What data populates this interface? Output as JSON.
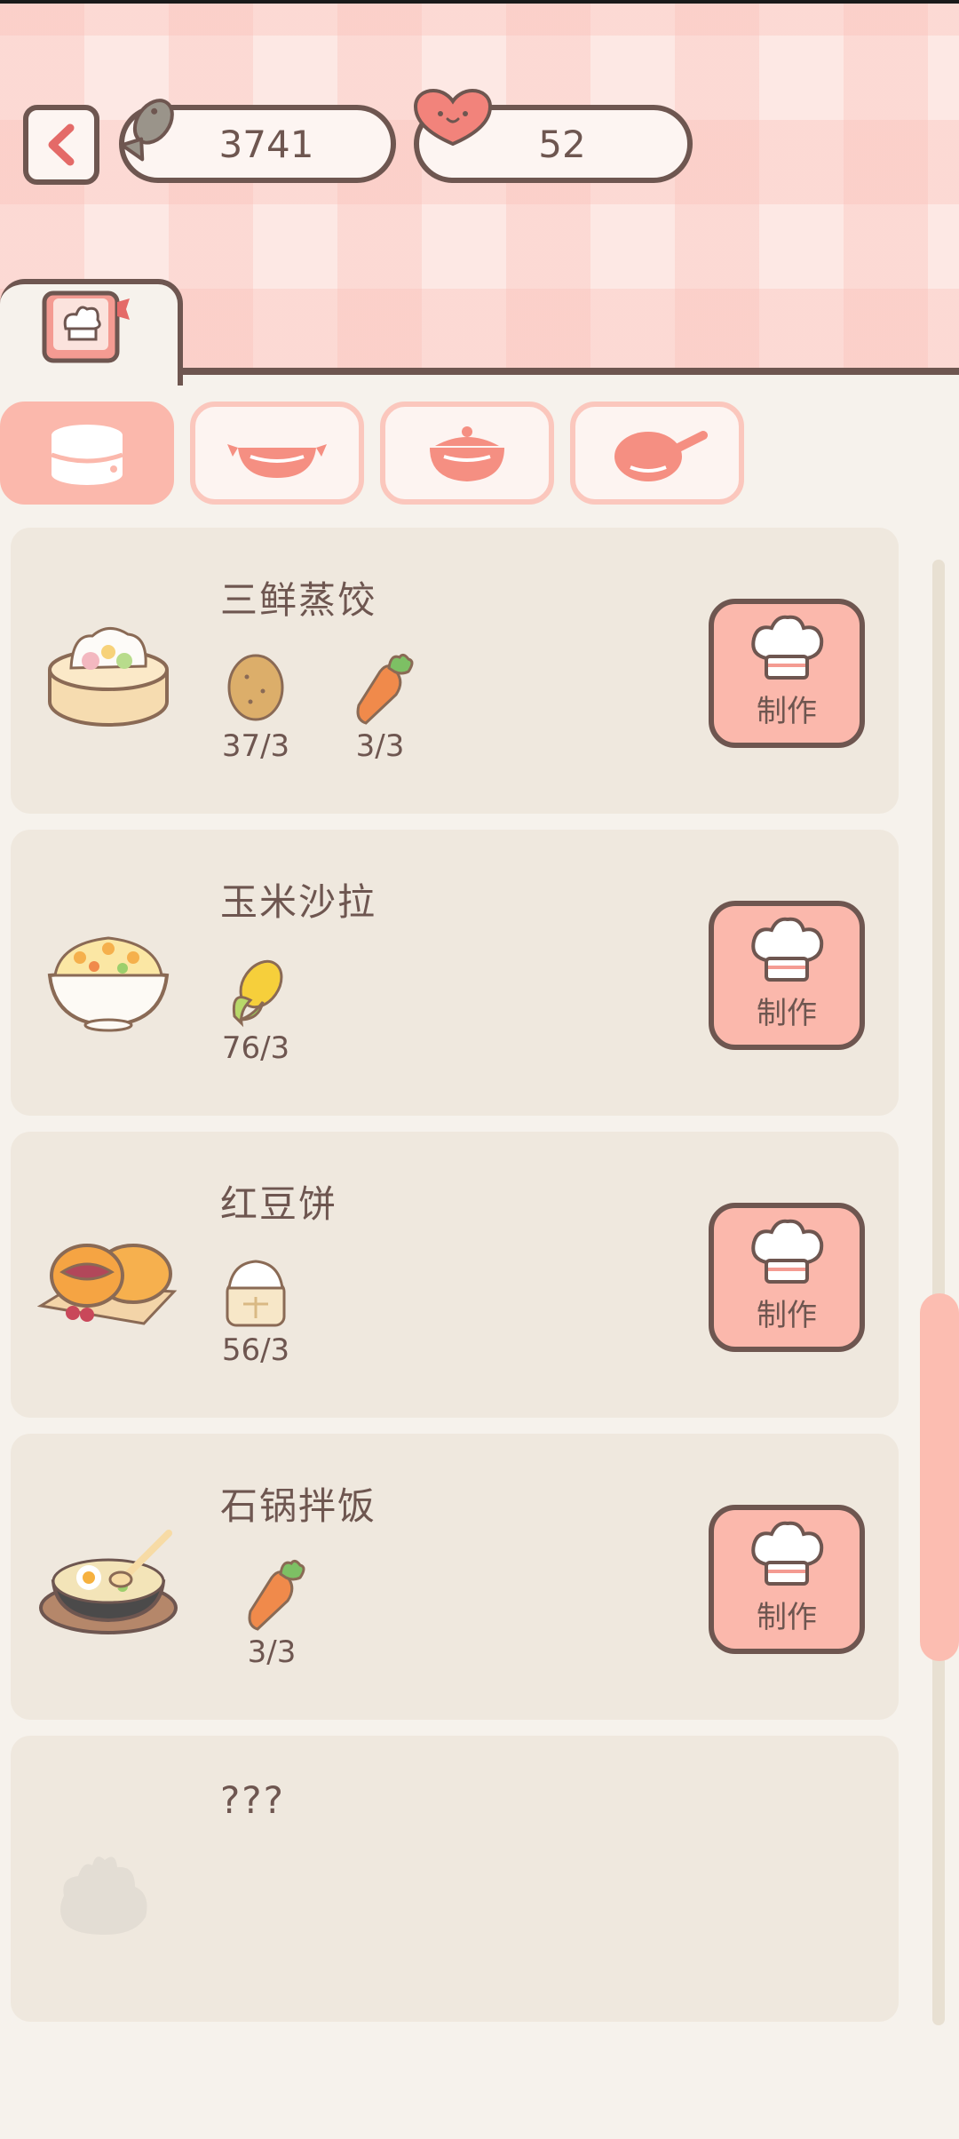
{
  "header": {
    "fish_count": "3741",
    "heart_count": "52"
  },
  "tabs": [
    {
      "id": "steamer",
      "active": true
    },
    {
      "id": "wok",
      "active": false
    },
    {
      "id": "pot",
      "active": false
    },
    {
      "id": "pan",
      "active": false
    }
  ],
  "recipes": [
    {
      "name": "三鲜蒸饺",
      "dish_icon": "steamed-dumplings",
      "ingredients": [
        {
          "icon": "potato",
          "count": "37/3"
        },
        {
          "icon": "carrot",
          "count": "3/3"
        }
      ],
      "button": "制作"
    },
    {
      "name": "玉米沙拉",
      "dish_icon": "corn-salad",
      "ingredients": [
        {
          "icon": "corn",
          "count": "76/3"
        }
      ],
      "button": "制作"
    },
    {
      "name": "红豆饼",
      "dish_icon": "red-bean-cake",
      "ingredients": [
        {
          "icon": "flour",
          "count": "56/3"
        }
      ],
      "button": "制作"
    },
    {
      "name": "石锅拌饭",
      "dish_icon": "stone-pot-bibimbap",
      "ingredients": [
        {
          "icon": "carrot",
          "count": "3/3"
        }
      ],
      "button": "制作"
    },
    {
      "name": "???",
      "dish_icon": "locked-dish",
      "ingredients": [],
      "button": ""
    }
  ],
  "colors": {
    "accent": "#fbb8ac",
    "outline": "#6e5650",
    "card": "#efe8de",
    "background": "#f6f2ec"
  }
}
